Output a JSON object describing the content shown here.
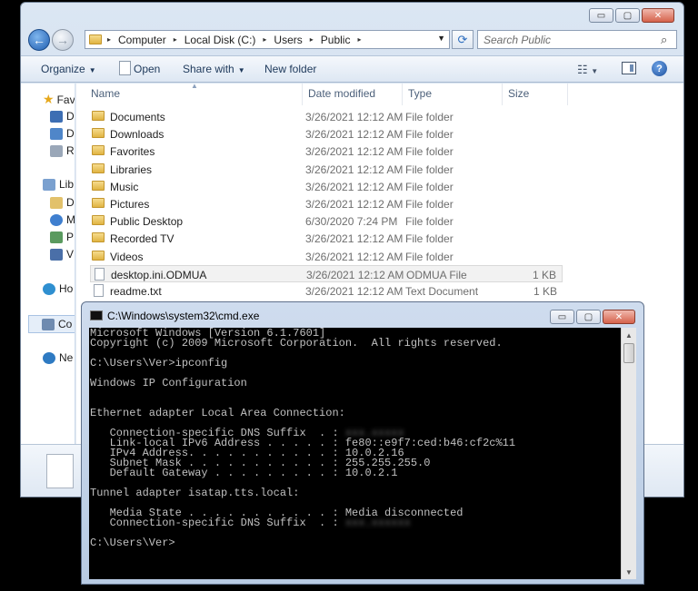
{
  "explorer": {
    "caption_buttons": {
      "minimize": "▭",
      "maximize": "▢",
      "close": "✕"
    },
    "address": {
      "crumbs": [
        "Computer",
        "Local Disk (C:)",
        "Users",
        "Public"
      ],
      "separator": "▸"
    },
    "search": {
      "placeholder": "Search Public"
    },
    "toolbar": {
      "organize": "Organize",
      "open": "Open",
      "share_with": "Share with",
      "new_folder": "New folder"
    },
    "nav_pane": {
      "items": [
        {
          "label": "Fav",
          "icon": "favorites-star-icon"
        },
        {
          "label": "D",
          "icon": "desktop-icon"
        },
        {
          "label": "D",
          "icon": "downloads-icon"
        },
        {
          "label": "R",
          "icon": "recent-places-icon"
        },
        {
          "label": "Lib",
          "icon": "libraries-icon"
        },
        {
          "label": "D",
          "icon": "documents-icon"
        },
        {
          "label": "M",
          "icon": "music-icon"
        },
        {
          "label": "P",
          "icon": "pictures-icon"
        },
        {
          "label": "V",
          "icon": "videos-icon"
        },
        {
          "label": "Ho",
          "icon": "homegroup-icon"
        },
        {
          "label": "Co",
          "icon": "computer-icon"
        },
        {
          "label": "Ne",
          "icon": "network-icon"
        }
      ]
    },
    "columns": {
      "name": "Name",
      "date": "Date modified",
      "type": "Type",
      "size": "Size"
    },
    "files": [
      {
        "name": "Documents",
        "date": "3/26/2021 12:12 AM",
        "type": "File folder",
        "size": "",
        "kind": "folder"
      },
      {
        "name": "Downloads",
        "date": "3/26/2021 12:12 AM",
        "type": "File folder",
        "size": "",
        "kind": "folder"
      },
      {
        "name": "Favorites",
        "date": "3/26/2021 12:12 AM",
        "type": "File folder",
        "size": "",
        "kind": "folder"
      },
      {
        "name": "Libraries",
        "date": "3/26/2021 12:12 AM",
        "type": "File folder",
        "size": "",
        "kind": "folder"
      },
      {
        "name": "Music",
        "date": "3/26/2021 12:12 AM",
        "type": "File folder",
        "size": "",
        "kind": "folder"
      },
      {
        "name": "Pictures",
        "date": "3/26/2021 12:12 AM",
        "type": "File folder",
        "size": "",
        "kind": "folder"
      },
      {
        "name": "Public Desktop",
        "date": "6/30/2020 7:24 PM",
        "type": "File folder",
        "size": "",
        "kind": "folder"
      },
      {
        "name": "Recorded TV",
        "date": "3/26/2021 12:12 AM",
        "type": "File folder",
        "size": "",
        "kind": "folder"
      },
      {
        "name": "Videos",
        "date": "3/26/2021 12:12 AM",
        "type": "File folder",
        "size": "",
        "kind": "folder"
      },
      {
        "name": "desktop.ini.ODMUA",
        "date": "3/26/2021 12:12 AM",
        "type": "ODMUA File",
        "size": "1 KB",
        "kind": "file",
        "selected": true
      },
      {
        "name": "readme.txt",
        "date": "3/26/2021 12:12 AM",
        "type": "Text Document",
        "size": "1 KB",
        "kind": "file"
      }
    ]
  },
  "cmd": {
    "title": "C:\\Windows\\system32\\cmd.exe",
    "caption_buttons": {
      "minimize": "▭",
      "maximize": "▢",
      "close": "✕"
    },
    "lines": [
      {
        "text": "Microsoft Windows [Version 6.1.7601]"
      },
      {
        "text": "Copyright (c) 2009 Microsoft Corporation.  All rights reserved."
      },
      {
        "text": ""
      },
      {
        "text": "C:\\Users\\Ver>ipconfig"
      },
      {
        "text": ""
      },
      {
        "text": "Windows IP Configuration"
      },
      {
        "text": ""
      },
      {
        "text": ""
      },
      {
        "text": "Ethernet adapter Local Area Connection:"
      },
      {
        "text": ""
      },
      {
        "text": "   Connection-specific DNS Suffix  . : ",
        "redacted": "xxx.xxxxx"
      },
      {
        "text": "   Link-local IPv6 Address . . . . . : fe80::e9f7:ced:b46:cf2c%11"
      },
      {
        "text": "   IPv4 Address. . . . . . . . . . . : 10.0.2.16"
      },
      {
        "text": "   Subnet Mask . . . . . . . . . . . : 255.255.255.0"
      },
      {
        "text": "   Default Gateway . . . . . . . . . : 10.0.2.1"
      },
      {
        "text": ""
      },
      {
        "text": "Tunnel adapter isatap.tts.local:"
      },
      {
        "text": ""
      },
      {
        "text": "   Media State . . . . . . . . . . . : Media disconnected"
      },
      {
        "text": "   Connection-specific DNS Suffix  . : ",
        "redacted": "xxx.xxxxxx"
      },
      {
        "text": ""
      },
      {
        "text": "C:\\Users\\Ver>"
      }
    ]
  }
}
